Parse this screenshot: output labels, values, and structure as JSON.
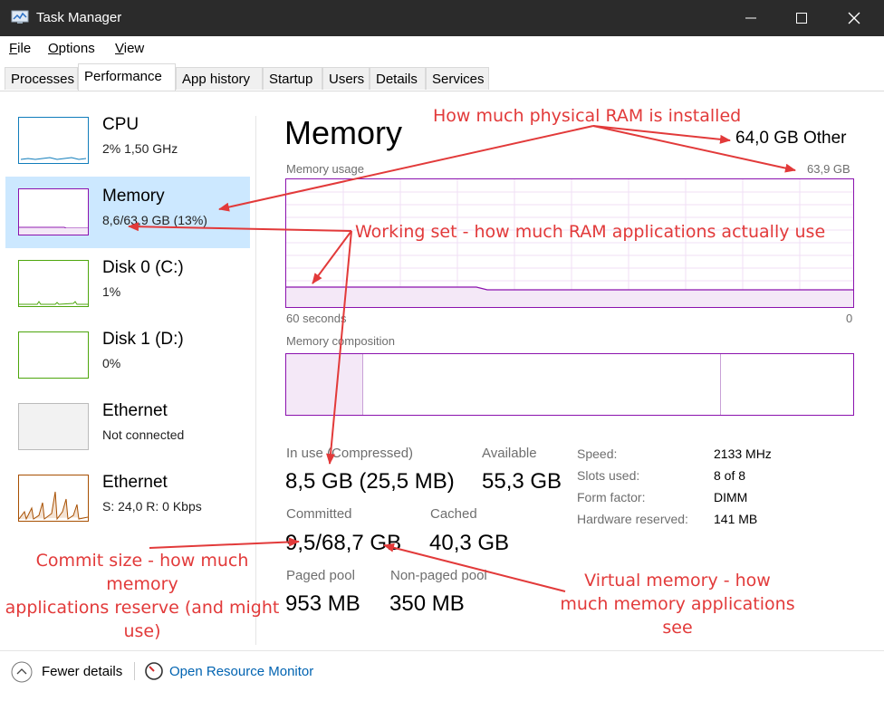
{
  "window": {
    "title": "Task Manager"
  },
  "menu": [
    "File",
    "Options",
    "View"
  ],
  "tabs": [
    "Processes",
    "Performance",
    "App history",
    "Startup",
    "Users",
    "Details",
    "Services"
  ],
  "sidebar": [
    {
      "name": "CPU",
      "sub": "2% 1,50 GHz"
    },
    {
      "name": "Memory",
      "sub": "8,6/63,9 GB (13%)"
    },
    {
      "name": "Disk 0 (C:)",
      "sub": "1%"
    },
    {
      "name": "Disk 1 (D:)",
      "sub": "0%"
    },
    {
      "name": "Ethernet",
      "sub": "Not connected"
    },
    {
      "name": "Ethernet",
      "sub": "S: 24,0 R: 0 Kbps"
    }
  ],
  "memory": {
    "title": "Memory",
    "total": "64,0 GB Other",
    "usage_label": "Memory usage",
    "usage_max": "63,9 GB",
    "graph_left": "60 seconds",
    "graph_right": "0",
    "composition_label": "Memory composition",
    "stats": {
      "in_use_label": "In use (Compressed)",
      "in_use_value": "8,5 GB (25,5 MB)",
      "available_label": "Available",
      "available_value": "55,3 GB",
      "committed_label": "Committed",
      "committed_value": "9,5/68,7 GB",
      "cached_label": "Cached",
      "cached_value": "40,3 GB",
      "paged_label": "Paged pool",
      "paged_value": "953 MB",
      "nonpaged_label": "Non-paged pool",
      "nonpaged_value": "350 MB"
    },
    "specs": [
      {
        "label": "Speed:",
        "value": "2133 MHz"
      },
      {
        "label": "Slots used:",
        "value": "8 of 8"
      },
      {
        "label": "Form factor:",
        "value": "DIMM"
      },
      {
        "label": "Hardware reserved:",
        "value": "141 MB"
      }
    ]
  },
  "footer": {
    "fewer": "Fewer details",
    "monitor": "Open Resource Monitor"
  },
  "annotations": {
    "ram_installed": "How much physical RAM is installed",
    "working_set": "Working set - how much RAM applications actually use",
    "commit_line1": "Commit size - how much memory",
    "commit_line2": "applications reserve (and might",
    "commit_line3": "use)",
    "virtual_line1": "Virtual memory - how",
    "virtual_line2": "much memory applications",
    "virtual_line3": "see"
  },
  "colors": {
    "memory": "#8b12ae",
    "cpu": "#117dbb",
    "disk": "#4da60c",
    "ethernet": "#a74f01",
    "selected": "#cce8ff",
    "annotation": "#e23a3a"
  }
}
